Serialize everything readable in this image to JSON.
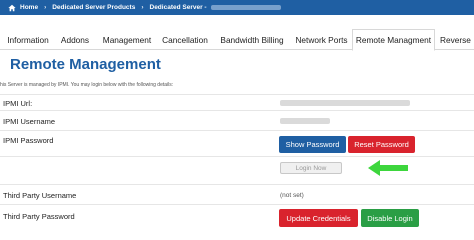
{
  "breadcrumb": {
    "home": "Home",
    "item1": "Dedicated Server Products",
    "item2": "Dedicated Server -"
  },
  "tabs": [
    {
      "label": "Information"
    },
    {
      "label": "Addons"
    },
    {
      "label": "Management"
    },
    {
      "label": "Cancellation"
    },
    {
      "label": "Bandwidth Billing"
    },
    {
      "label": "Network Ports"
    },
    {
      "label": "Remote Managment",
      "active": true
    },
    {
      "label": "Reverse I"
    }
  ],
  "page": {
    "title": "Remote Management",
    "subtitle": "his Server is managed by IPMI. You may login below with the following details:"
  },
  "rows": {
    "ipmi_url": "IPMI Url:",
    "ipmi_username": "IPMI Username",
    "ipmi_password": "IPMI Password",
    "third_party_username": "Third Party Username",
    "third_party_password": "Third Party Password",
    "third_party_username_value": "(not set)"
  },
  "buttons": {
    "show_password": "Show Password",
    "reset_password": "Reset Password",
    "login_now": "Login Now",
    "update_credentials": "Update Credentials",
    "disable_login": "Disable Login"
  },
  "colors": {
    "brand_blue": "#1f5fa3",
    "danger_red": "#d9232d",
    "success_green": "#2a9e45",
    "arrow_green": "#3dd63d"
  },
  "icons": {
    "home": "home-icon",
    "arrow": "left-arrow-icon"
  }
}
